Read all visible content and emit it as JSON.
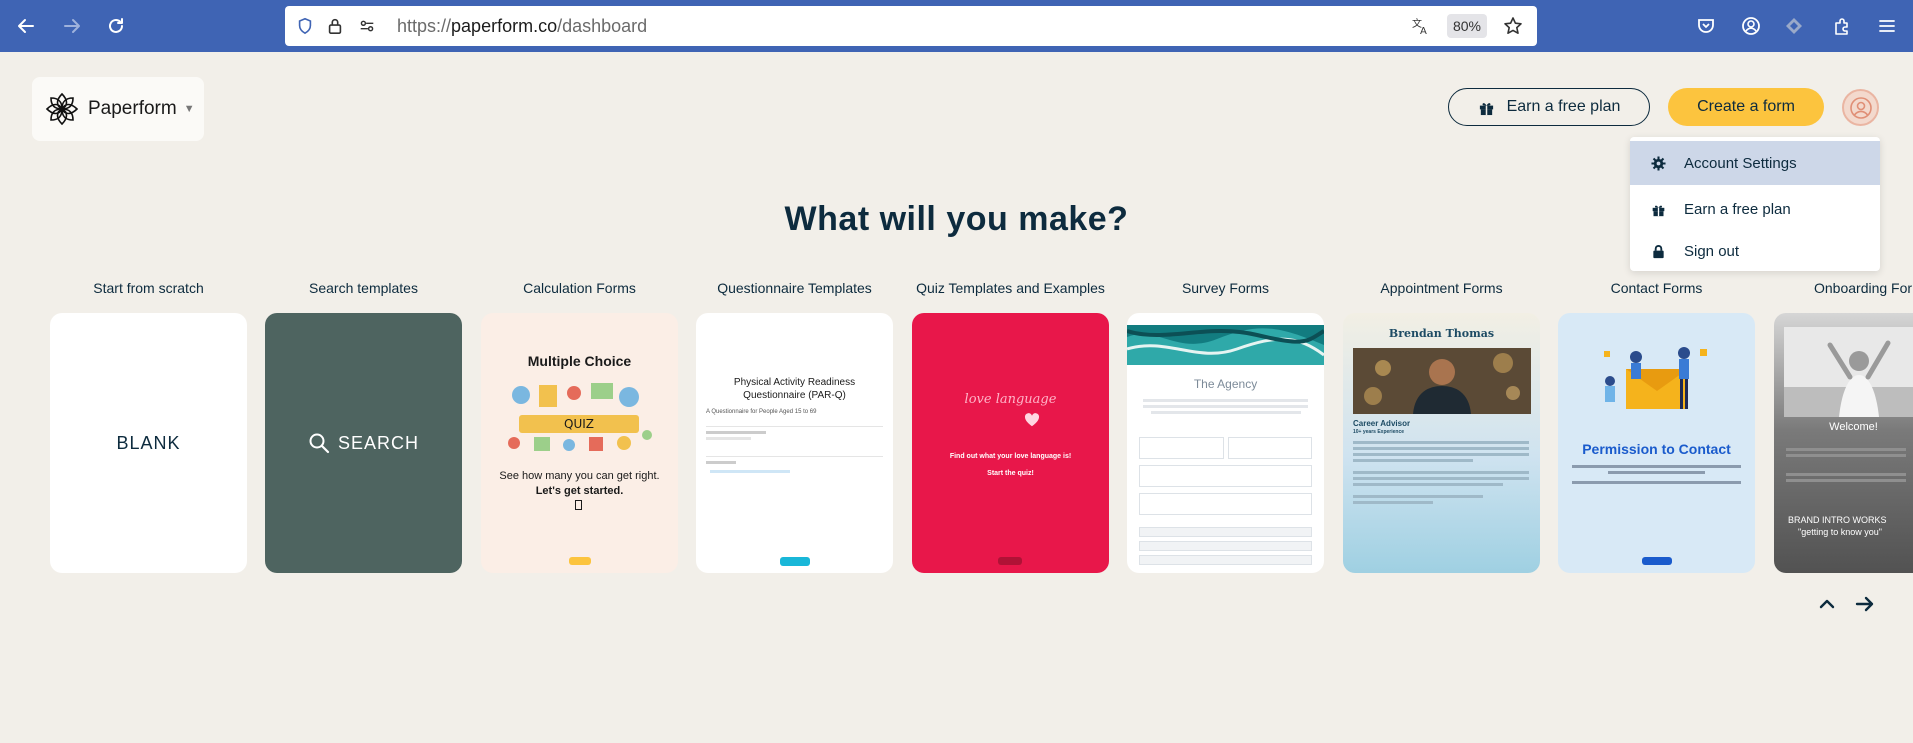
{
  "browser": {
    "url_prefix": "https://",
    "url_host": "paperform.co",
    "url_path": "/dashboard",
    "zoom": "80%",
    "accent": "#3f64b4"
  },
  "header": {
    "logo_text": "Paperform",
    "earn_label": "Earn a free plan",
    "create_label": "Create a form",
    "create_color": "#fcc43e"
  },
  "menu": {
    "items": [
      {
        "label": "Account Settings",
        "icon": "gear-icon"
      },
      {
        "label": "Earn a free plan",
        "icon": "gift-icon"
      },
      {
        "label": "Sign out",
        "icon": "lock-icon"
      }
    ]
  },
  "main": {
    "title": "What will you make?"
  },
  "cards": [
    {
      "label": "Start from scratch",
      "text": "BLANK"
    },
    {
      "label": "Search templates",
      "text": "SEARCH"
    },
    {
      "label": "Calculation Forms",
      "heading": "Multiple Choice",
      "body1": "See how many you can get right.",
      "body2": "Let's get started."
    },
    {
      "label": "Questionnaire Templates",
      "heading": "Physical Activity Readiness Questionnaire (PAR-Q)",
      "sub": "A Questionnaire for People Aged 15 to 69"
    },
    {
      "label": "Quiz Templates and Examples",
      "script": "love language",
      "body1": "Find out what your love language is!",
      "body2": "Start the quiz!"
    },
    {
      "label": "Survey Forms",
      "heading": "The Agency"
    },
    {
      "label": "Appointment Forms",
      "heading": "Brendan Thomas",
      "sub": "Career Advisor",
      "sub2": "10+ years Experience"
    },
    {
      "label": "Contact Forms",
      "heading": "Permission to Contact"
    },
    {
      "label": "Onboarding For",
      "heading": "Welcome!",
      "sub": "BRAND INTRO WORKS",
      "sub2": "\"getting to know you\""
    }
  ]
}
